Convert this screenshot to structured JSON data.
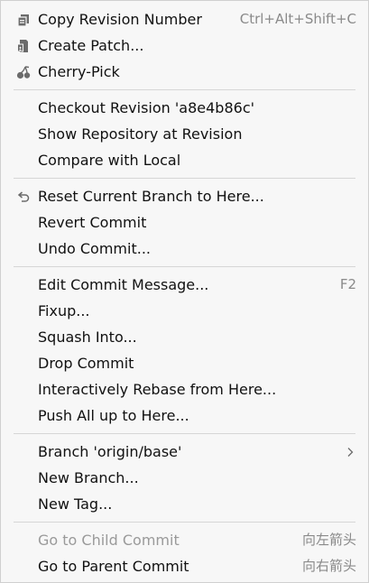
{
  "menu": {
    "group1": {
      "copy_revision": {
        "label": "Copy Revision Number",
        "shortcut": "Ctrl+Alt+Shift+C",
        "icon": "copy-icon"
      },
      "create_patch": {
        "label": "Create Patch...",
        "icon": "patch-icon"
      },
      "cherry_pick": {
        "label": "Cherry-Pick",
        "icon": "cherry-icon"
      }
    },
    "group2": {
      "checkout_revision": {
        "label": "Checkout Revision 'a8e4b86c'"
      },
      "show_repository": {
        "label": "Show Repository at Revision"
      },
      "compare_local": {
        "label": "Compare with Local"
      }
    },
    "group3": {
      "reset_branch": {
        "label": "Reset Current Branch to Here...",
        "icon": "undo-arrow-icon"
      },
      "revert_commit": {
        "label": "Revert Commit"
      },
      "undo_commit": {
        "label": "Undo Commit..."
      }
    },
    "group4": {
      "edit_message": {
        "label": "Edit Commit Message...",
        "shortcut": "F2"
      },
      "fixup": {
        "label": "Fixup..."
      },
      "squash_into": {
        "label": "Squash Into..."
      },
      "drop_commit": {
        "label": "Drop Commit"
      },
      "interactive_rebase": {
        "label": "Interactively Rebase from Here..."
      },
      "push_all": {
        "label": "Push All up to Here..."
      }
    },
    "group5": {
      "branch_origin": {
        "label": "Branch 'origin/base'",
        "icon": "chevron-right-icon"
      },
      "new_branch": {
        "label": "New Branch..."
      },
      "new_tag": {
        "label": "New Tag..."
      }
    },
    "group6": {
      "go_child": {
        "label": "Go to Child Commit",
        "shortcut": "向左箭头",
        "disabled": true
      },
      "go_parent": {
        "label": "Go to Parent Commit",
        "shortcut": "向右箭头"
      }
    }
  },
  "colors": {
    "background": "#f7f7f7",
    "text": "#111111",
    "shortcut": "#8a8a8a",
    "disabled": "#9a9a9a",
    "separator": "#d6d6d6",
    "icon": "#6b6b6b"
  }
}
